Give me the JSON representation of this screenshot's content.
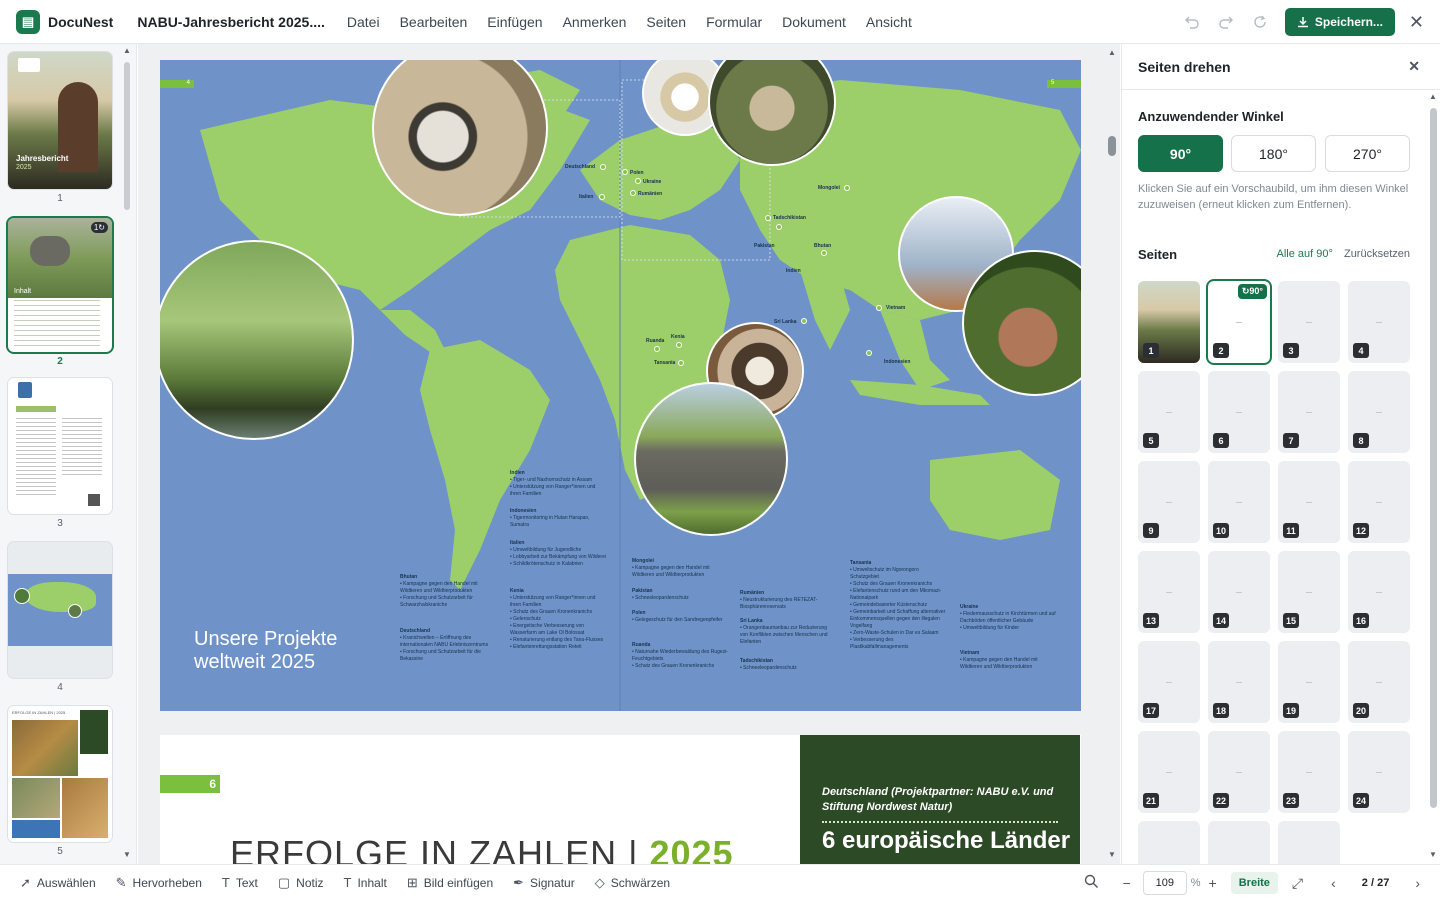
{
  "app": {
    "logo_letter": "▤",
    "name": "DocuNest",
    "doc_title": "NABU-Jahresbericht 2025....",
    "menu": [
      "Datei",
      "Bearbeiten",
      "Einfügen",
      "Anmerken",
      "Seiten",
      "Formular",
      "Dokument",
      "Ansicht"
    ],
    "save_label": "Speichern..."
  },
  "thumbnails": [
    {
      "num": "1",
      "caption": "Jahresbericht",
      "sub": "2025"
    },
    {
      "num": "2",
      "badge": "1↻",
      "caption": "Inhalt"
    },
    {
      "num": "3"
    },
    {
      "num": "4"
    },
    {
      "num": "5",
      "caption": "ERFOLGE IN ZAHLEN | 2025"
    }
  ],
  "page4": {
    "page_left_num": "4",
    "page_right_num": "5",
    "title_line1": "Unsere Projekte",
    "title_line2": "weltweit 2025",
    "countries": [
      {
        "name": "Deutschland"
      },
      {
        "name": "Polen"
      },
      {
        "name": "Ukraine"
      },
      {
        "name": "Rumänien"
      },
      {
        "name": "Italien"
      },
      {
        "name": "Mongolei"
      },
      {
        "name": "Tadschikistan"
      },
      {
        "name": "Pakistan"
      },
      {
        "name": "Bhutan"
      },
      {
        "name": "Indien"
      },
      {
        "name": "Vietnam"
      },
      {
        "name": "Sri Lanka"
      },
      {
        "name": "Indonesien"
      },
      {
        "name": "Ruanda"
      },
      {
        "name": "Kenia"
      },
      {
        "name": "Tansania"
      }
    ],
    "legend": [
      {
        "head": "Indien",
        "items": [
          "Tiger- und Nashornschutz in Assam",
          "Unterstützung von Ranger*innen und ihren Familien"
        ]
      },
      {
        "head": "Indonesien",
        "items": [
          "Tigermonitoring in Hutan Harapan, Sumatra"
        ]
      },
      {
        "head": "Italien",
        "items": [
          "Umweltbildung für Jugendliche",
          "Lobbyarbeit zur Bekämpfung von Wilderei",
          "Schildkrötenschutz in Kalabrien"
        ]
      },
      {
        "head": "Kenia",
        "items": [
          "Unterstützung von Ranger*innen und ihren Familien",
          "Schutz des Grauen Kronenkranichs",
          "Gelenschutz",
          "Energetische Verbesserung von Wasserfarm am Lake Ol Bolossat",
          "Renaturierung entlang des Tana-Flusses",
          "Elefantenrettungsstation Reteti"
        ]
      },
      {
        "head": "Bhutan",
        "items": [
          "Kampagne gegen den Handel mit Wildtieren und Wildtierprodukten",
          "Forschung und Schutzarbeit für Schwarzhalskraniche"
        ]
      },
      {
        "head": "Deutschland",
        "items": [
          "Kranichwelten – Eröffnung des internationalen NABU Erlebniszentrums",
          "Forschung und Schutzarbeit für die Bekassine"
        ]
      },
      {
        "head": "Mongolei",
        "items": [
          "Kampagne gegen den Handel mit Wildtieren und Wildtierprodukten"
        ]
      },
      {
        "head": "Pakistan",
        "items": [
          "Schneeleopardenschutz"
        ]
      },
      {
        "head": "Polen",
        "items": [
          "Gelegeschutz für den Sandregenpfeifer"
        ]
      },
      {
        "head": "Ruanda",
        "items": [
          "Naturnahe Wiederbewaldung des Rugezi-Feuchtgebiets",
          "Schutz des Grauen Kronenkranichs"
        ]
      },
      {
        "head": "Rumänien",
        "items": [
          "Neustrukturierung des RETEZAT-Biosphärenreservats"
        ]
      },
      {
        "head": "Sri Lanka",
        "items": [
          "Orangenbaumanbau zur Reduzierung von Konflikten zwischen Menschen und Elefanten"
        ]
      },
      {
        "head": "Tadschikistan",
        "items": [
          "Schneeleopardenschutz"
        ]
      },
      {
        "head": "Tansania",
        "items": [
          "Umweltschutz im Ngorongoro Schutzgebiet",
          "Schutz des Grauen Kronenkranichs",
          "Elefantenschutz rund um den Mkomazi-Nationalpark",
          "Gemeindebasierter Küstenschutz",
          "Gemeinbarkeit und Schaffung alternativer Einkommensquellen gegen den illegalen Vogelfang",
          "Zero-Waste-Schulen in Dar es Salaam",
          "Verbesserung des Plastikabfallmanagements"
        ]
      },
      {
        "head": "Ukraine",
        "items": [
          "Fledermausschutz in Kirchtürmen und auf Dachböden öffentlicher Gebäude",
          "Umweltbildung für Kinder"
        ]
      },
      {
        "head": "Vietnam",
        "items": [
          "Kampagne gegen den Handel mit Wildtieren und Wildtierprodukten"
        ]
      }
    ]
  },
  "page6": {
    "page_num": "6",
    "heading": "ERFOLGE IN ZAHLEN | ",
    "heading_year": "2025",
    "box_sub": "Deutschland (Projektpartner: NABU e.V. und Stiftung Nordwest Natur)",
    "box_big": "6 europäische Länder"
  },
  "panel": {
    "title": "Seiten drehen",
    "angle_label": "Anzuwendender Winkel",
    "angles": [
      "90°",
      "180°",
      "270°"
    ],
    "active_angle": "90°",
    "hint": "Klicken Sie auf ein Vorschaubild, um ihm diesen Winkel zuzuweisen (erneut klicken zum Entfernen).",
    "pages_label": "Seiten",
    "all_90": "Alle auf 90°",
    "reset": "Zurücksetzen",
    "selected_rotation": "↻90°",
    "page_numbers": [
      "1",
      "2",
      "3",
      "4",
      "5",
      "6",
      "7",
      "8",
      "9",
      "10",
      "11",
      "12",
      "13",
      "14",
      "15",
      "16",
      "17",
      "18",
      "19",
      "20",
      "21",
      "22",
      "23",
      "24"
    ]
  },
  "toolbar": {
    "tools": [
      "Auswählen",
      "Hervorheben",
      "Text",
      "Notiz",
      "Inhalt",
      "Bild einfügen",
      "Signatur",
      "Schwärzen"
    ],
    "zoom": "109",
    "zoom_unit": "%",
    "width_label": "Breite",
    "page_indicator": "2 / 27"
  },
  "colors": {
    "accent": "#15714a",
    "map_ocean": "#6f93c9",
    "map_land": "#9ccf6a",
    "dark_green_box": "#2d4a26"
  }
}
